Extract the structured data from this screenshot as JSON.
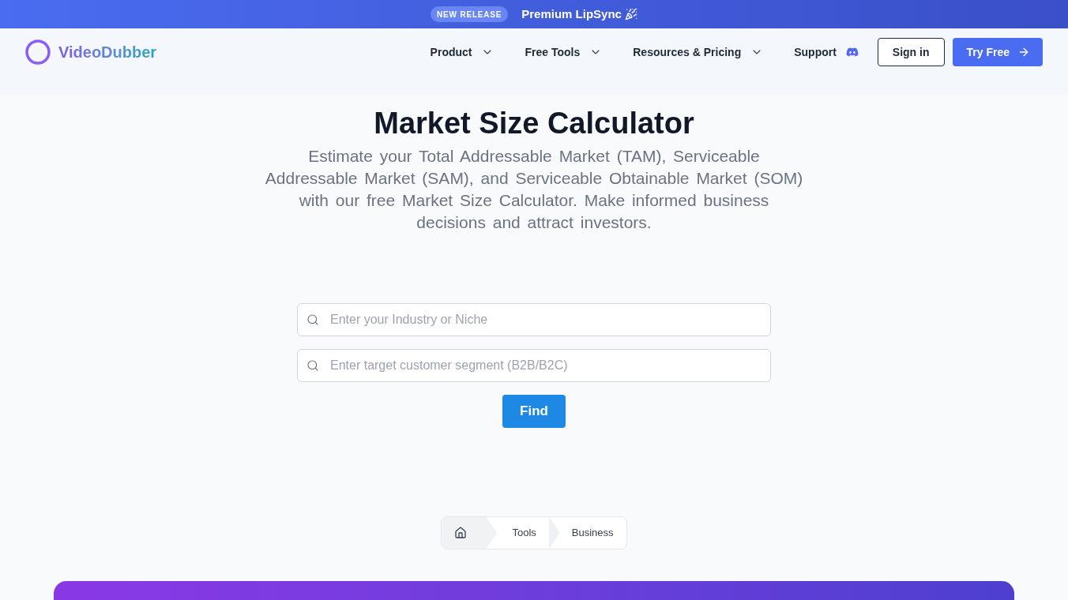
{
  "announcement": {
    "badge": "NEW RELEASE",
    "text": "Premium LipSync"
  },
  "nav": {
    "logo": "VideoDubber",
    "items": [
      {
        "label": "Product",
        "kind": "dropdown"
      },
      {
        "label": "Free Tools",
        "kind": "dropdown"
      },
      {
        "label": "Resources & Pricing",
        "kind": "dropdown"
      },
      {
        "label": "Support",
        "kind": "discord"
      }
    ],
    "buttons": [
      {
        "label": "Sign in",
        "kind": "outline"
      },
      {
        "label": "Try Free",
        "kind": "primary"
      }
    ]
  },
  "hero": {
    "title": "Market Size Calculator",
    "subtitle": "Estimate your Total Addressable Market (TAM), Serviceable Addressable Market (SAM), and Serviceable Obtainable Market (SOM) with our free Market Size Calculator. Make informed business decisions and attract investors."
  },
  "form": {
    "fields": [
      {
        "placeholder": "Enter your Industry or Niche"
      },
      {
        "placeholder": "Enter target customer segment (B2B/B2C)"
      }
    ],
    "submit": "Find"
  },
  "breadcrumb": [
    {
      "kind": "home"
    },
    {
      "kind": "link",
      "label": "Tools"
    },
    {
      "kind": "link",
      "label": "Business"
    }
  ]
}
